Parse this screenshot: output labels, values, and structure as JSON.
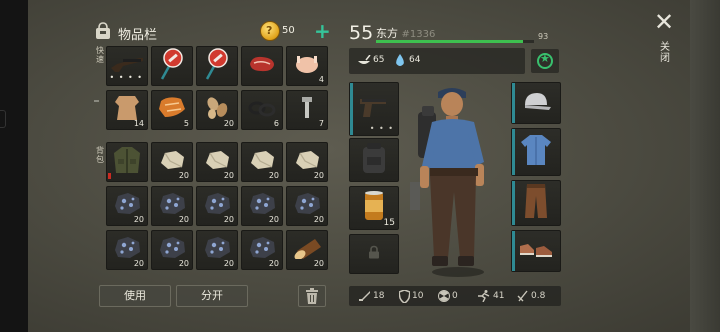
{
  "inventory": {
    "title": "物品栏",
    "coins": "50",
    "coin_symbol": "?",
    "add_symbol": "+",
    "quick_label": "快速",
    "bag_label": "背包",
    "quick_row": [
      {
        "icon": "rifle-icon",
        "qty": "",
        "durability": "• • • •"
      },
      {
        "icon": "no-entry-sign-icon",
        "qty": "",
        "durability": ""
      },
      {
        "icon": "no-entry-sign-icon",
        "qty": "",
        "durability": ""
      },
      {
        "icon": "raw-meat-icon",
        "qty": "",
        "durability": ""
      },
      {
        "icon": "raw-chicken-icon",
        "qty": "4",
        "durability": ""
      },
      {
        "icon": "leather-hide-icon",
        "qty": "14",
        "durability": ""
      },
      {
        "icon": "fabric-scraps-icon",
        "qty": "5",
        "durability": ""
      },
      {
        "icon": "seeds-icon",
        "qty": "20",
        "durability": ""
      },
      {
        "icon": "rubber-rings-icon",
        "qty": "6",
        "durability": ""
      },
      {
        "icon": "bolts-icon",
        "qty": "7",
        "durability": ""
      }
    ],
    "bag": [
      {
        "icon": "jacket-icon",
        "qty": ""
      },
      {
        "icon": "stone-icon",
        "qty": "20"
      },
      {
        "icon": "stone-icon",
        "qty": "20"
      },
      {
        "icon": "stone-icon",
        "qty": "20"
      },
      {
        "icon": "stone-icon",
        "qty": "20"
      },
      {
        "icon": "iron-ore-icon",
        "qty": "20"
      },
      {
        "icon": "iron-ore-icon",
        "qty": "20"
      },
      {
        "icon": "iron-ore-icon",
        "qty": "20"
      },
      {
        "icon": "iron-ore-icon",
        "qty": "20"
      },
      {
        "icon": "iron-ore-icon",
        "qty": "20"
      },
      {
        "icon": "iron-ore-icon",
        "qty": "20"
      },
      {
        "icon": "iron-ore-icon",
        "qty": "20"
      },
      {
        "icon": "iron-ore-icon",
        "qty": "20"
      },
      {
        "icon": "iron-ore-icon",
        "qty": "20"
      },
      {
        "icon": "wood-log-icon",
        "qty": "20"
      }
    ],
    "use_label": "使用",
    "split_label": "分开",
    "trash_icon": "trash-icon"
  },
  "character": {
    "level": "55",
    "name": "东方",
    "id": "#1336",
    "xp_value": "93",
    "xp_fraction": 0.93,
    "food": "65",
    "water": "64",
    "badge_icon": "star-badge-icon",
    "left_slots": [
      {
        "icon": "pistol-icon",
        "qty": "",
        "dots": "• • •"
      },
      {
        "icon": "backpack-icon",
        "qty": "",
        "dots": ""
      },
      {
        "icon": "canned-food-icon",
        "qty": "15",
        "dots": ""
      },
      {
        "icon": "lock-icon",
        "qty": "",
        "dots": ""
      }
    ],
    "right_slots": [
      {
        "icon": "cap-icon"
      },
      {
        "icon": "shirt-icon"
      },
      {
        "icon": "pants-icon"
      },
      {
        "icon": "shoes-icon"
      }
    ],
    "combat": {
      "attack": "18",
      "defense": "10",
      "radiation": "0",
      "speed": "41",
      "weight": "0.8"
    }
  },
  "close_label": "关闭",
  "colors": {
    "accent_green": "#35c49a",
    "xp_green": "#3ec04f",
    "slot_accent": "#2f8a93",
    "no_entry_red": "#c92b22"
  }
}
